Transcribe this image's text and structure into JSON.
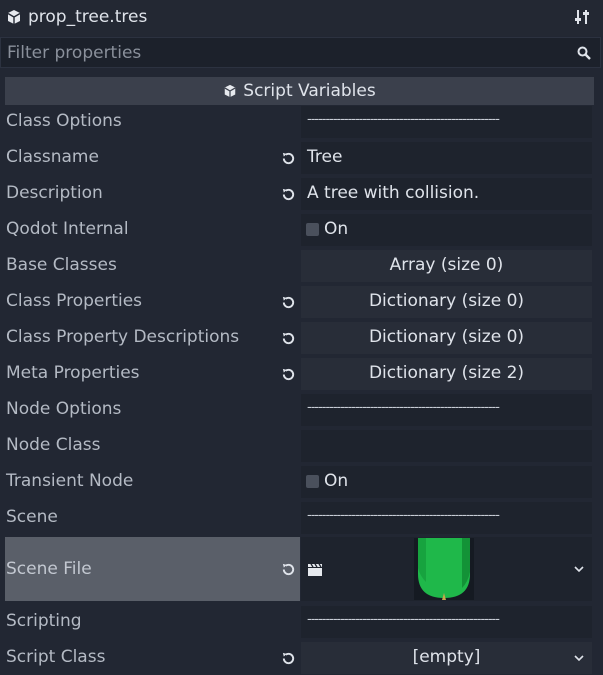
{
  "header": {
    "title": "prop_tree.tres",
    "icon": "resource-cube-icon",
    "settings_icon": "object-settings-icon"
  },
  "filter": {
    "placeholder": "Filter properties",
    "value": ""
  },
  "section": {
    "title": "Script Variables",
    "icon": "cube-icon"
  },
  "rows": {
    "class_options": {
      "label": "Class Options",
      "value": "----------------------------------------------------"
    },
    "classname": {
      "label": "Classname",
      "value": "Tree"
    },
    "description": {
      "label": "Description",
      "value": "A tree with collision."
    },
    "qodot_internal": {
      "label": "Qodot Internal",
      "checkbox": "On",
      "checked": false
    },
    "base_classes": {
      "label": "Base Classes",
      "value": "Array (size 0)"
    },
    "class_properties": {
      "label": "Class Properties",
      "value": "Dictionary (size 0)"
    },
    "class_property_descriptions": {
      "label": "Class Property Descriptions",
      "value": "Dictionary (size 0)"
    },
    "meta_properties": {
      "label": "Meta Properties",
      "value": "Dictionary (size 2)"
    },
    "node_options": {
      "label": "Node Options",
      "value": "----------------------------------------------------"
    },
    "node_class": {
      "label": "Node Class",
      "value": ""
    },
    "transient_node": {
      "label": "Transient Node",
      "checkbox": "On",
      "checked": false
    },
    "scene": {
      "label": "Scene",
      "value": "----------------------------------------------------"
    },
    "scene_file": {
      "label": "Scene File",
      "thumbnail": "tree-preview",
      "icon": "clapperboard-icon"
    },
    "scripting": {
      "label": "Scripting",
      "value": "----------------------------------------------------"
    },
    "script_class": {
      "label": "Script Class",
      "value": "[empty]"
    }
  },
  "colors": {
    "background": "#222733",
    "field": "#1e232d",
    "accent_green": "#20b84a",
    "selected_row": "#5a5f69"
  }
}
